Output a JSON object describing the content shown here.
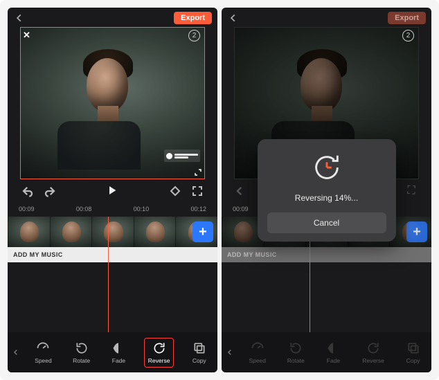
{
  "export_label": "Export",
  "preview_badge": "2",
  "timecodesA": [
    "00:09",
    "00:08",
    "00:10",
    "00:12"
  ],
  "timecodesB": [
    "00:09"
  ],
  "music_label": "ADD MY MUSIC",
  "tools": {
    "speed": "Speed",
    "rotate": "Rotate",
    "fade": "Fade",
    "reverse": "Reverse",
    "copy": "Copy"
  },
  "modal": {
    "status": "Reversing 14%...",
    "cancel": "Cancel"
  }
}
